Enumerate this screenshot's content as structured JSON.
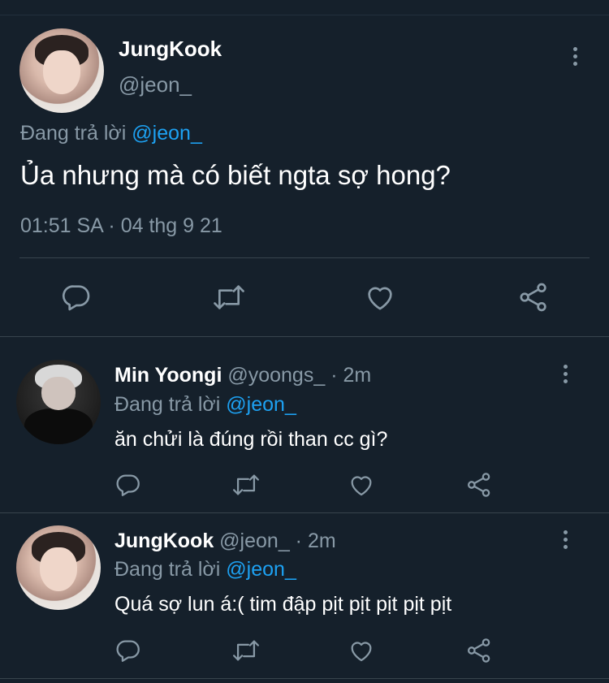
{
  "main_tweet": {
    "name": "JungKook",
    "handle": "@jeon_",
    "reply_prefix": "Đang trả lời",
    "reply_to": "@jeon_",
    "text": "Ủa nhưng mà có biết ngta sợ hong?",
    "timestamp": "01:51 SA · 04 thg 9 21",
    "actions": [
      "reply-icon",
      "retweet-icon",
      "like-icon",
      "share-icon"
    ]
  },
  "replies": [
    {
      "name": "Min Yoongi",
      "handle": "@yoongs_",
      "time": " · 2m",
      "reply_prefix": "Đang trả lời",
      "reply_to": "@jeon_",
      "text": "ăn chửi là đúng rồi than cc gì?"
    },
    {
      "name": "JungKook",
      "handle": "@jeon_",
      "time": " · 2m",
      "reply_prefix": "Đang trả lời",
      "reply_to": "@jeon_",
      "text": "Quá sợ lun á:( tim đập pịt pịt pịt pịt pịt"
    }
  ],
  "colors": {
    "background": "#15202b",
    "text_primary": "#ffffff",
    "text_secondary": "#8899a6",
    "link": "#1da1f2",
    "divider": "#38444d"
  }
}
